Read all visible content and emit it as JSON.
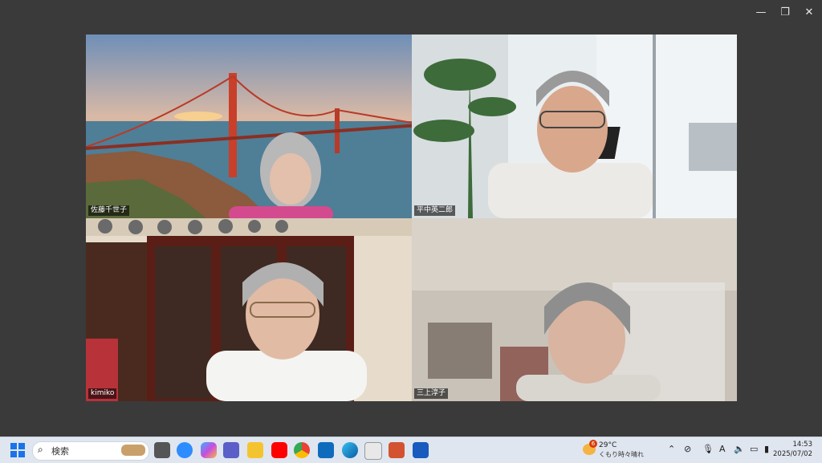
{
  "window": {
    "minimize_icon": "minimize-icon",
    "restore_icon": "restore-icon",
    "close_icon": "close-icon"
  },
  "participants": [
    {
      "name": "佐藤千世子",
      "active": false,
      "background": "golden-gate-bridge-sunset"
    },
    {
      "name": "平中英二郎",
      "active": false,
      "background": "office-window-plant"
    },
    {
      "name": "kimiko",
      "active": false,
      "background": "kitchen-cabinet"
    },
    {
      "name": "三上淳子",
      "active": true,
      "background": "blurred-room"
    }
  ],
  "colors": {
    "active_border": "#2fd07a",
    "desktop": "#3a3a3a",
    "taskbar": "#dfe6ef"
  },
  "taskbar": {
    "search_placeholder": "検索",
    "weather_badge": "6",
    "weather_temp": "29°C",
    "weather_desc": "くもり時々晴れ",
    "time": "14:53",
    "date": "2025/07/02",
    "ime": "A",
    "apps": [
      "windows-start",
      "task-view",
      "zoom",
      "copilot",
      "teams",
      "file-explorer",
      "youtube",
      "chrome",
      "outlook",
      "edge",
      "notepad",
      "powerpoint",
      "word"
    ]
  }
}
